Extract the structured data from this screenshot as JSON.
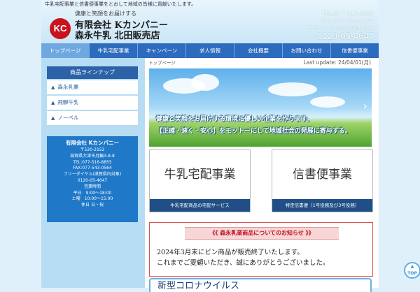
{
  "header": {
    "tagline": "牛乳宅配事業と信書便事業をとおして地域の皆様に貢献いたします。",
    "logo_text": "KC",
    "catch": "健康と笑顔をお届けする",
    "company_line1": "有限会社 Kカンパニー",
    "company_line2": "森永牛乳 北田販売店",
    "tel": "TEL:077-516-8855",
    "fax": "FAX:077-543-0564",
    "freedial_label": "フリーダイヤル(滋賀県内対象)",
    "freedial": "0120-05-4647"
  },
  "nav": {
    "items": [
      "トップページ",
      "牛乳宅配事業",
      "キャンペーン",
      "求人情報",
      "会社概要",
      "お問い合わせ",
      "信書便事業"
    ],
    "active_index": 0
  },
  "sidebar": {
    "heading": "商品ラインナップ",
    "items": [
      "森永乳業",
      "飛騨牛乳",
      "ノーベル"
    ],
    "company": {
      "name": "有限会社 Kカンパニー",
      "postal": "〒520-2152",
      "address": "滋賀県大津市月輪3-8-8",
      "tel": "TEL:077-516-8855",
      "fax": "FAX:077-543-0564",
      "freedial_label": "フリーダイヤル(滋賀県内対象)",
      "freedial": "0120-05-4647",
      "hours_label": "営業時間",
      "weekday": "平日　9:00〜18:00",
      "saturday": "土曜　10:00〜15:00",
      "holiday": "休日 日・祝"
    }
  },
  "main": {
    "breadcrumb": "トップページ",
    "last_update": "Last update: 24/04/01(月)",
    "banner_line1": "健康と笑顔をお届けする環境に優しい企業を作ります。",
    "banner_line2": "【正確・速く・安心】をモットーにして地域社会の発展に寄与する。",
    "banner_arrow": "›",
    "cards": [
      {
        "title": "牛乳宅配事業",
        "caption": "牛乳宅配商品の宅配サービス"
      },
      {
        "title": "信書便事業",
        "caption": "特定信書便（1号役務及び3号役務）"
      }
    ],
    "notice": {
      "heading": "《《 森永乳業商品についてのお知らせ 》》",
      "line1": "2024年3月末にビン商品が販売終了いたします。",
      "line2": "これまでご愛顧いただき、誠にありがとうございました。"
    },
    "corona_heading": "新型コロナウイルス"
  },
  "to_top": {
    "line1": "▲",
    "line2": "TOP"
  }
}
